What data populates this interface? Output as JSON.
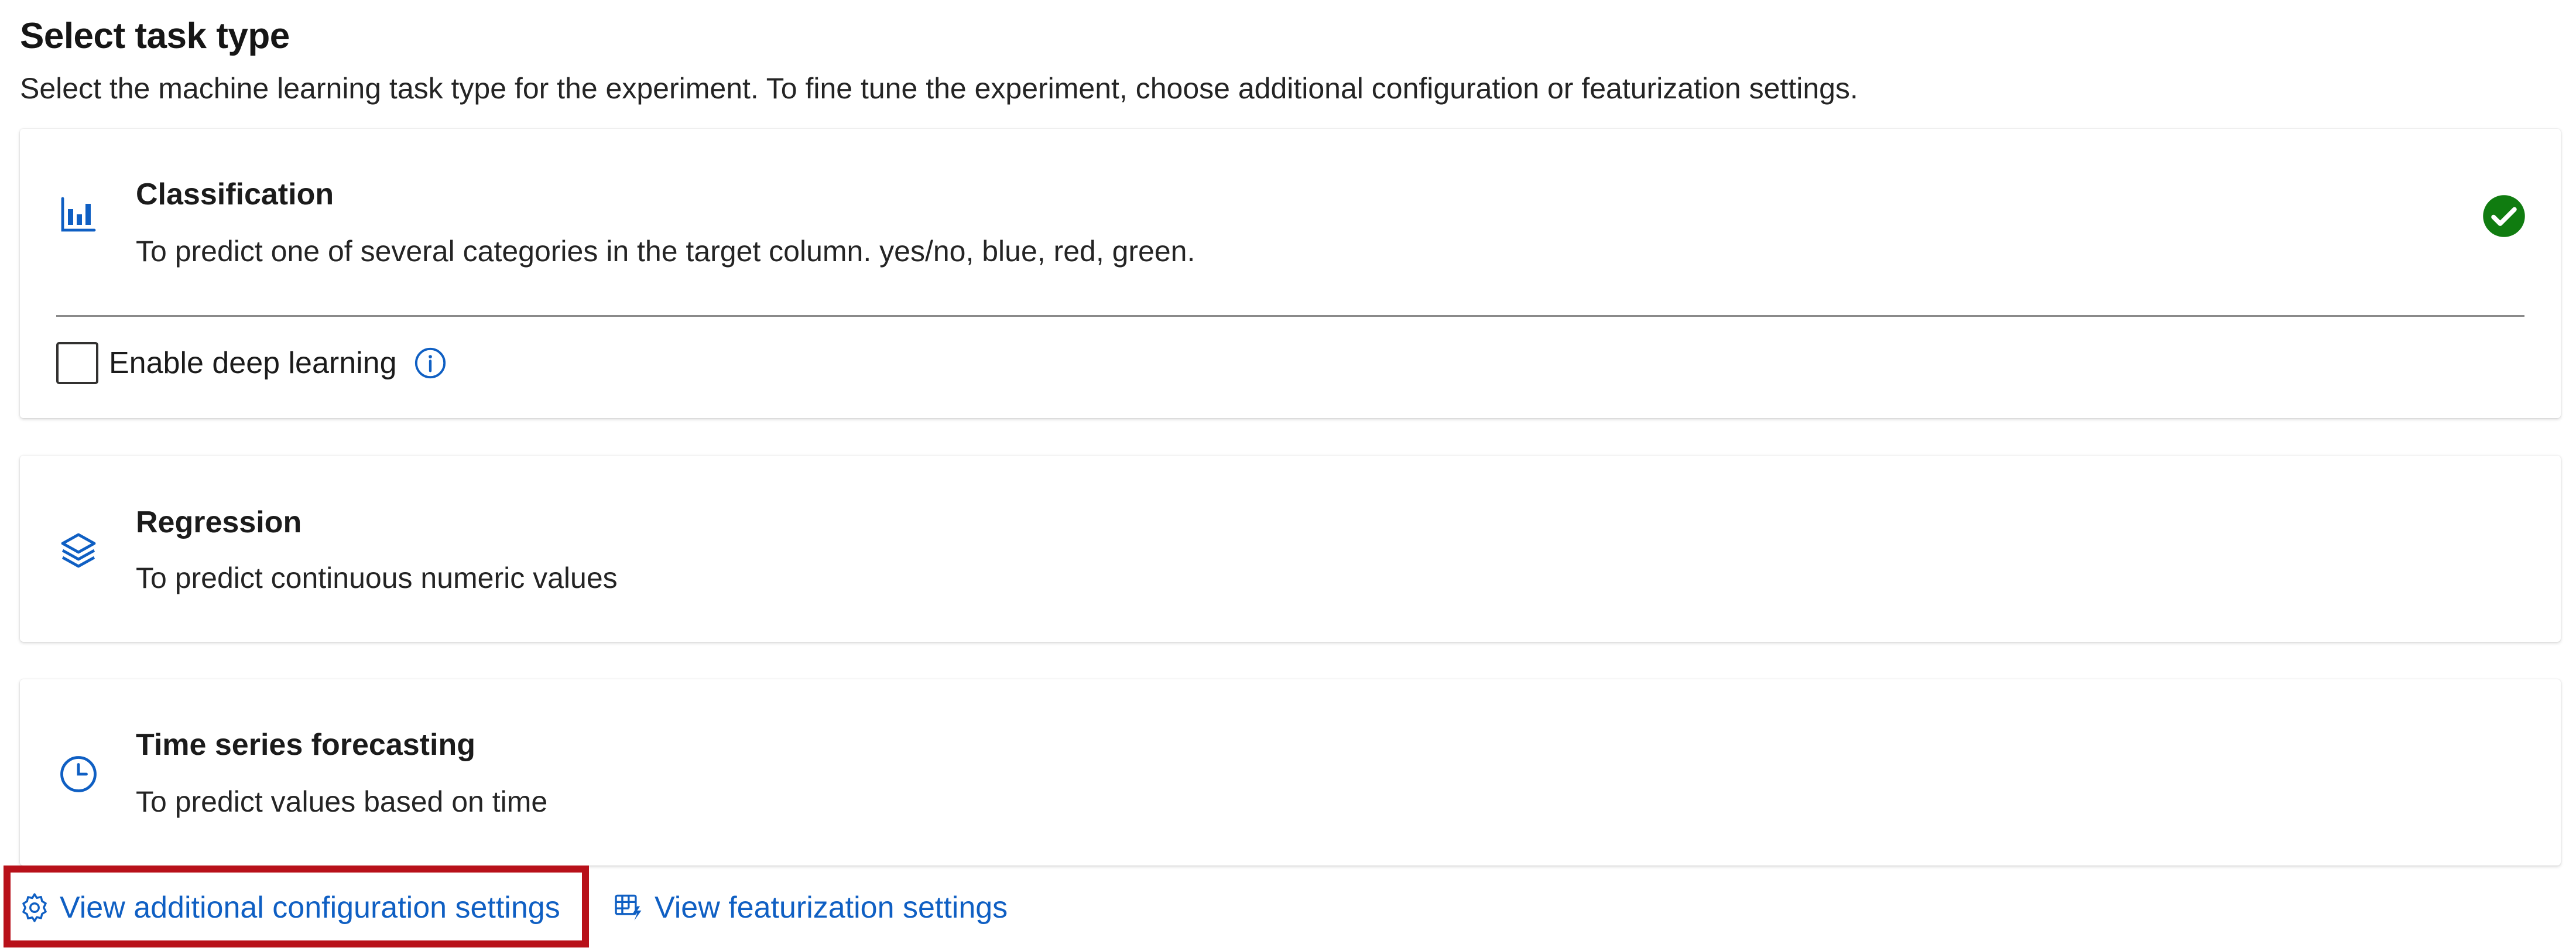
{
  "header": {
    "title": "Select task type",
    "description": "Select the machine learning task type for the experiment. To fine tune the experiment, choose additional configuration or featurization settings."
  },
  "tasks": [
    {
      "title": "Classification",
      "description": "To predict one of several categories in the target column. yes/no, blue, red, green.",
      "icon": "bar-chart-icon",
      "selected": true,
      "option": {
        "label": "Enable deep learning",
        "checked": false,
        "icon": "info-icon"
      }
    },
    {
      "title": "Regression",
      "description": "To predict continuous numeric values",
      "icon": "layers-icon",
      "selected": false
    },
    {
      "title": "Time series forecasting",
      "description": "To predict values based on time",
      "icon": "clock-icon",
      "selected": false
    }
  ],
  "links": {
    "additional_config": "View additional configuration settings",
    "featurization": "View featurization settings"
  },
  "colors": {
    "accent": "#0f5fc3",
    "selected_check": "#107c10",
    "highlight_border": "#b8111a"
  }
}
